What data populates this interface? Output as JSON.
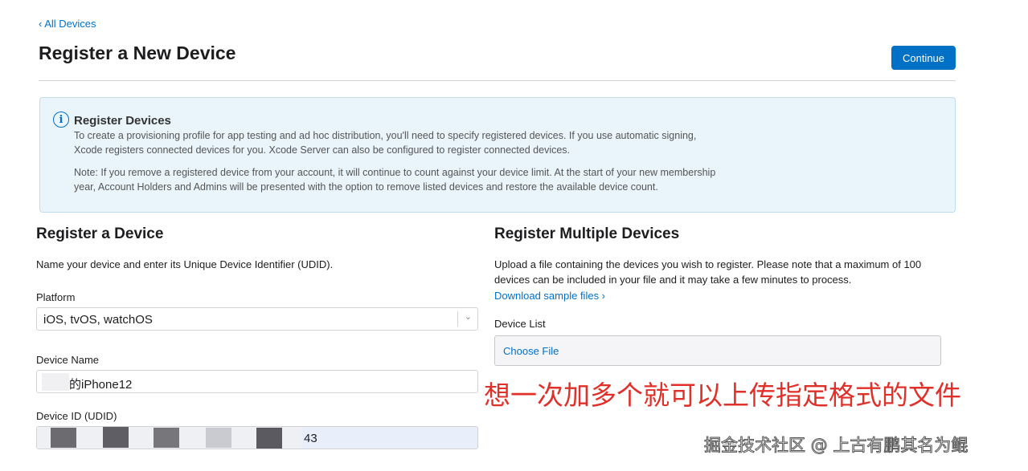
{
  "header": {
    "back_link": "‹ All Devices",
    "title": "Register a New Device",
    "continue_label": "Continue"
  },
  "info": {
    "icon": "info-icon",
    "icon_glyph": "i",
    "title": "Register Devices",
    "paragraph1": "To create a provisioning profile for app testing and ad hoc distribution, you'll need to specify registered devices. If you use automatic signing, Xcode registers connected devices for you. Xcode Server can also be configured to register connected devices.",
    "paragraph2": "Note: If you remove a registered device from your account, it will continue to count against your device limit. At the start of your new membership year, Account Holders and Admins will be presented with the option to remove listed devices and restore the available device count."
  },
  "register_device": {
    "title": "Register a Device",
    "description": "Name your device and enter its Unique Device Identifier (UDID).",
    "platform_label": "Platform",
    "platform_value": "iOS, tvOS, watchOS",
    "device_name_label": "Device Name",
    "device_name_value": "的iPhone12",
    "device_id_label": "Device ID (UDID)",
    "device_id_value": "43"
  },
  "register_multiple": {
    "title": "Register Multiple Devices",
    "description": "Upload a file containing the devices you wish to register. Please note that a maximum of 100 devices can be included in your file and it may take a few minutes to process.",
    "download_link": "Download sample files ›",
    "device_list_label": "Device List",
    "choose_file_label": "Choose File"
  },
  "annotation": "想一次加多个就可以上传指定格式的文件",
  "watermark": "掘金技术社区 @ 上古有鹏其名为鲲",
  "colors": {
    "accent": "#0071c5",
    "link": "#0070c9",
    "info_bg": "#eaf4fb",
    "annotation": "#e0302a"
  }
}
